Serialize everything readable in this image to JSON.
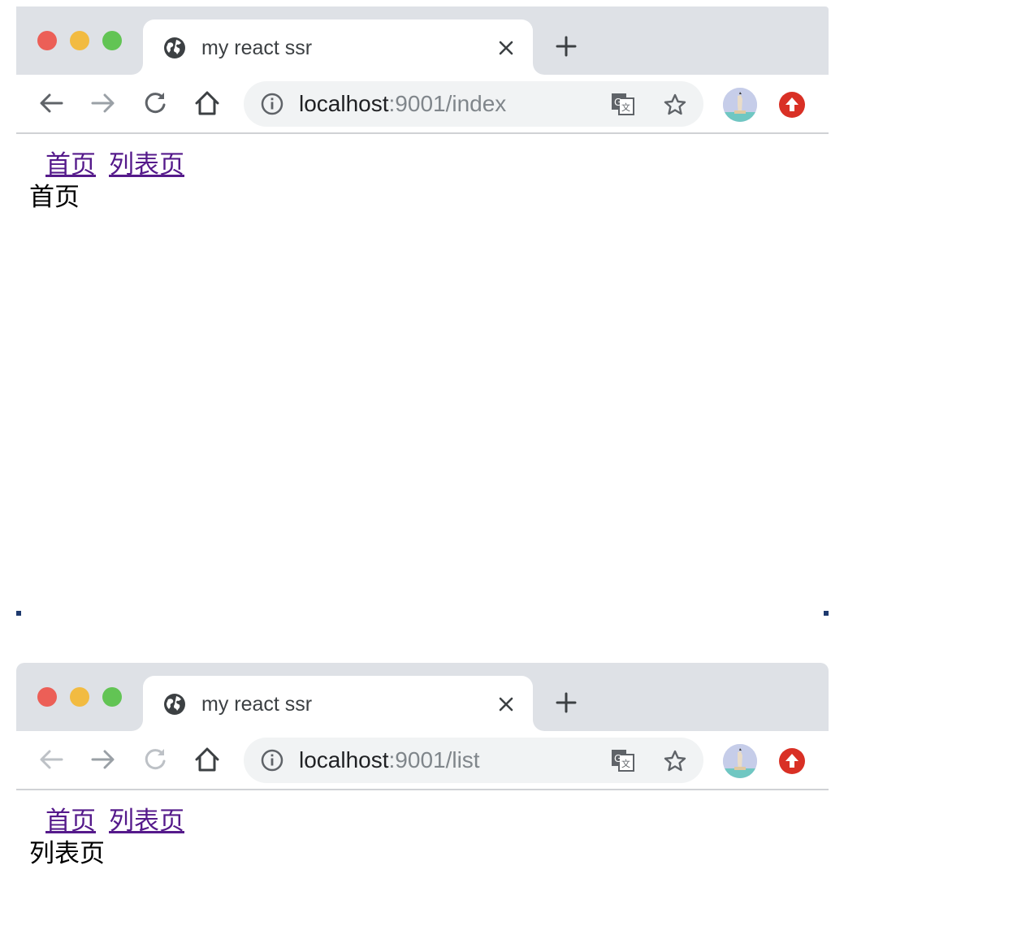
{
  "windows": [
    {
      "tab": {
        "title": "my react ssr"
      },
      "address_bar": {
        "host": "localhost",
        "rest": ":9001/index"
      },
      "nav": {
        "home_link": "首页",
        "list_link": "列表页"
      },
      "page": {
        "text": "首页"
      },
      "toolbar_state": {
        "back_enabled": true,
        "reload_enabled": true
      }
    },
    {
      "tab": {
        "title": "my react ssr"
      },
      "address_bar": {
        "host": "localhost",
        "rest": ":9001/list"
      },
      "nav": {
        "home_link": "首页",
        "list_link": "列表页"
      },
      "page": {
        "text": "列表页"
      },
      "toolbar_state": {
        "back_enabled": false,
        "reload_enabled": false
      }
    }
  ],
  "icons": {
    "favicon": "globe-icon",
    "close": "close-icon",
    "new_tab": "plus-icon",
    "back": "back-arrow-icon",
    "forward": "forward-arrow-icon",
    "reload": "reload-icon",
    "home": "home-icon",
    "info": "info-icon",
    "translate": "translate-icon",
    "bookmark": "star-icon",
    "profile": "avatar",
    "extension": "upload-extension-icon"
  },
  "colors": {
    "tabstrip": "#dee1e6",
    "traffic_red": "#ec5f57",
    "traffic_yellow": "#f2bb41",
    "traffic_green": "#62c454",
    "link_visited": "#551a8b",
    "extension_red": "#d93025"
  }
}
